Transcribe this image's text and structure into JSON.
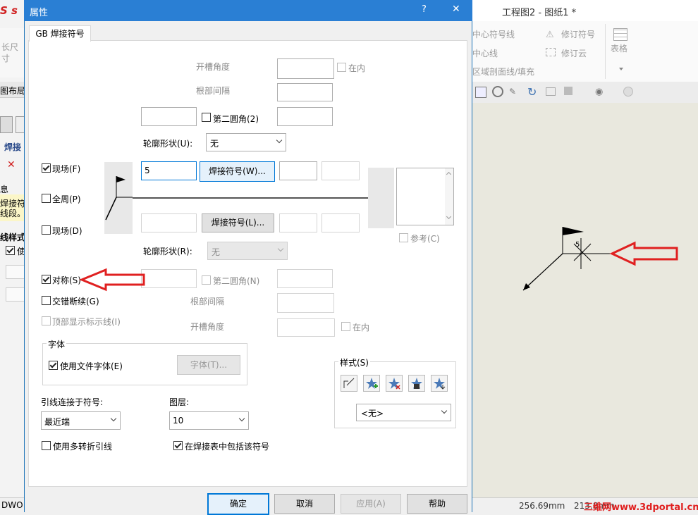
{
  "app": {
    "title": "工程图2 - 图纸1 *",
    "left_labels": [
      "S s",
      "长尺",
      "寸",
      "图布局",
      "焊接",
      "息",
      "焊接符",
      "线段。",
      "线样式",
      "使"
    ],
    "ribbon": {
      "items": [
        "中心符号线",
        "中心线",
        "区域剖面线/填充",
        "修订符号",
        "修订云",
        "表格"
      ]
    },
    "status": {
      "value1": "256.69mm",
      "value2": "213.8mm",
      "watermark": "三维网www.3dportal.cn"
    },
    "left_status": "DWO"
  },
  "dialog": {
    "title": "属性",
    "help_glyph": "?",
    "close_glyph": "✕",
    "tab": "GB 焊接符号",
    "upper": {
      "groove_angle_label": "开槽角度",
      "inside_label": "在内",
      "root_gap_label": "根部间隔",
      "second_fillet_label": "第二圆角(2)",
      "contour_label": "轮廓形状(U):",
      "contour_value": "无",
      "field_value": "5",
      "weld_symbol_button": "焊接符号(W)..."
    },
    "lower": {
      "weld_symbol_button": "焊接符号(L)...",
      "contour_label": "轮廓形状(R):",
      "contour_value": "无",
      "second_fillet_label": "第二圆角(N)",
      "root_gap_label": "根部间隔",
      "groove_angle_label": "开槽角度",
      "inside_label": "在内"
    },
    "left_options": {
      "field_upper": "现场(F)",
      "all_around": "全周(P)",
      "field_lower": "现场(D)",
      "symmetric": "对称(S)",
      "staggered": "交错断续(G)",
      "top_show": "顶部显示标示线(I)"
    },
    "reference_label": "参考(C)",
    "font_group": {
      "title": "字体",
      "use_doc_font": "使用文件字体(E)",
      "font_button": "字体(T)..."
    },
    "style_group": {
      "title": "样式(S)",
      "select_value": "<无>"
    },
    "leader_anchor": {
      "label": "引线连接于符号:",
      "value": "最近端"
    },
    "layer": {
      "label": "图层:",
      "value": "10"
    },
    "multi_jog_leader": "使用多转折引线",
    "include_in_table": "在焊接表中包括该符号",
    "buttons": {
      "ok": "确定",
      "cancel": "取消",
      "apply": "应用(A)",
      "help": "帮助"
    }
  },
  "canvas": {
    "weld_number": "5"
  },
  "colors": {
    "titlebar": "#2a7fd4",
    "annotation_arrow": "#e02020",
    "canvas": "#e9e8de",
    "accent_button": "#0078d7"
  }
}
